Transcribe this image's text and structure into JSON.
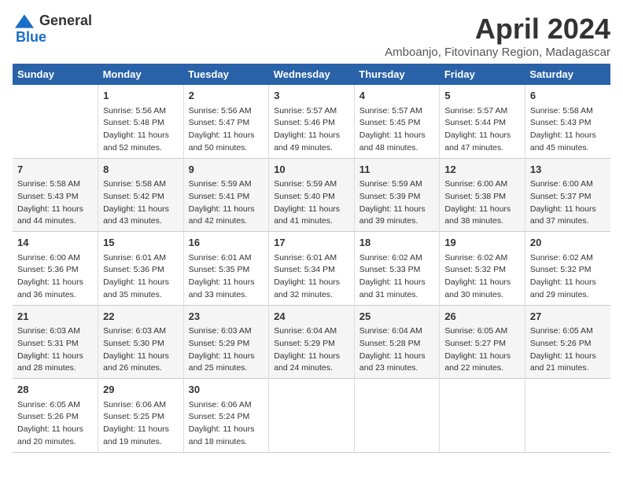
{
  "logo": {
    "general": "General",
    "blue": "Blue"
  },
  "title": "April 2024",
  "location": "Amboanjo, Fitovinany Region, Madagascar",
  "weekdays": [
    "Sunday",
    "Monday",
    "Tuesday",
    "Wednesday",
    "Thursday",
    "Friday",
    "Saturday"
  ],
  "weeks": [
    [
      {
        "day": "",
        "info": ""
      },
      {
        "day": "1",
        "info": "Sunrise: 5:56 AM\nSunset: 5:48 PM\nDaylight: 11 hours\nand 52 minutes."
      },
      {
        "day": "2",
        "info": "Sunrise: 5:56 AM\nSunset: 5:47 PM\nDaylight: 11 hours\nand 50 minutes."
      },
      {
        "day": "3",
        "info": "Sunrise: 5:57 AM\nSunset: 5:46 PM\nDaylight: 11 hours\nand 49 minutes."
      },
      {
        "day": "4",
        "info": "Sunrise: 5:57 AM\nSunset: 5:45 PM\nDaylight: 11 hours\nand 48 minutes."
      },
      {
        "day": "5",
        "info": "Sunrise: 5:57 AM\nSunset: 5:44 PM\nDaylight: 11 hours\nand 47 minutes."
      },
      {
        "day": "6",
        "info": "Sunrise: 5:58 AM\nSunset: 5:43 PM\nDaylight: 11 hours\nand 45 minutes."
      }
    ],
    [
      {
        "day": "7",
        "info": "Sunrise: 5:58 AM\nSunset: 5:43 PM\nDaylight: 11 hours\nand 44 minutes."
      },
      {
        "day": "8",
        "info": "Sunrise: 5:58 AM\nSunset: 5:42 PM\nDaylight: 11 hours\nand 43 minutes."
      },
      {
        "day": "9",
        "info": "Sunrise: 5:59 AM\nSunset: 5:41 PM\nDaylight: 11 hours\nand 42 minutes."
      },
      {
        "day": "10",
        "info": "Sunrise: 5:59 AM\nSunset: 5:40 PM\nDaylight: 11 hours\nand 41 minutes."
      },
      {
        "day": "11",
        "info": "Sunrise: 5:59 AM\nSunset: 5:39 PM\nDaylight: 11 hours\nand 39 minutes."
      },
      {
        "day": "12",
        "info": "Sunrise: 6:00 AM\nSunset: 5:38 PM\nDaylight: 11 hours\nand 38 minutes."
      },
      {
        "day": "13",
        "info": "Sunrise: 6:00 AM\nSunset: 5:37 PM\nDaylight: 11 hours\nand 37 minutes."
      }
    ],
    [
      {
        "day": "14",
        "info": "Sunrise: 6:00 AM\nSunset: 5:36 PM\nDaylight: 11 hours\nand 36 minutes."
      },
      {
        "day": "15",
        "info": "Sunrise: 6:01 AM\nSunset: 5:36 PM\nDaylight: 11 hours\nand 35 minutes."
      },
      {
        "day": "16",
        "info": "Sunrise: 6:01 AM\nSunset: 5:35 PM\nDaylight: 11 hours\nand 33 minutes."
      },
      {
        "day": "17",
        "info": "Sunrise: 6:01 AM\nSunset: 5:34 PM\nDaylight: 11 hours\nand 32 minutes."
      },
      {
        "day": "18",
        "info": "Sunrise: 6:02 AM\nSunset: 5:33 PM\nDaylight: 11 hours\nand 31 minutes."
      },
      {
        "day": "19",
        "info": "Sunrise: 6:02 AM\nSunset: 5:32 PM\nDaylight: 11 hours\nand 30 minutes."
      },
      {
        "day": "20",
        "info": "Sunrise: 6:02 AM\nSunset: 5:32 PM\nDaylight: 11 hours\nand 29 minutes."
      }
    ],
    [
      {
        "day": "21",
        "info": "Sunrise: 6:03 AM\nSunset: 5:31 PM\nDaylight: 11 hours\nand 28 minutes."
      },
      {
        "day": "22",
        "info": "Sunrise: 6:03 AM\nSunset: 5:30 PM\nDaylight: 11 hours\nand 26 minutes."
      },
      {
        "day": "23",
        "info": "Sunrise: 6:03 AM\nSunset: 5:29 PM\nDaylight: 11 hours\nand 25 minutes."
      },
      {
        "day": "24",
        "info": "Sunrise: 6:04 AM\nSunset: 5:29 PM\nDaylight: 11 hours\nand 24 minutes."
      },
      {
        "day": "25",
        "info": "Sunrise: 6:04 AM\nSunset: 5:28 PM\nDaylight: 11 hours\nand 23 minutes."
      },
      {
        "day": "26",
        "info": "Sunrise: 6:05 AM\nSunset: 5:27 PM\nDaylight: 11 hours\nand 22 minutes."
      },
      {
        "day": "27",
        "info": "Sunrise: 6:05 AM\nSunset: 5:26 PM\nDaylight: 11 hours\nand 21 minutes."
      }
    ],
    [
      {
        "day": "28",
        "info": "Sunrise: 6:05 AM\nSunset: 5:26 PM\nDaylight: 11 hours\nand 20 minutes."
      },
      {
        "day": "29",
        "info": "Sunrise: 6:06 AM\nSunset: 5:25 PM\nDaylight: 11 hours\nand 19 minutes."
      },
      {
        "day": "30",
        "info": "Sunrise: 6:06 AM\nSunset: 5:24 PM\nDaylight: 11 hours\nand 18 minutes."
      },
      {
        "day": "",
        "info": ""
      },
      {
        "day": "",
        "info": ""
      },
      {
        "day": "",
        "info": ""
      },
      {
        "day": "",
        "info": ""
      }
    ]
  ]
}
